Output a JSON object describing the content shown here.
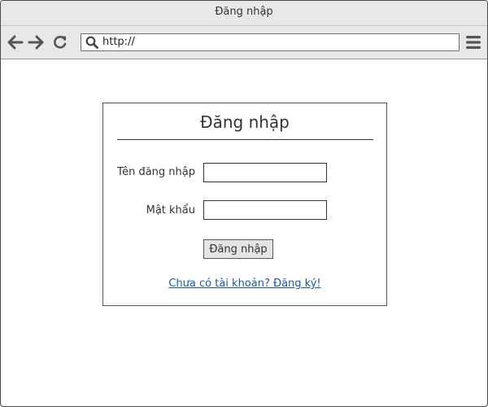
{
  "window": {
    "title": "Đăng nhập"
  },
  "toolbar": {
    "back_icon": "arrow-left-icon",
    "forward_icon": "arrow-right-icon",
    "reload_icon": "reload-icon",
    "search_icon": "search-icon",
    "menu_icon": "hamburger-menu-icon",
    "address_value": "http://"
  },
  "login": {
    "title": "Đăng nhập",
    "username_label": "Tên đăng nhập",
    "username_value": "",
    "password_label": "Mật khẩu",
    "password_value": "",
    "submit_label": "Đăng nhập",
    "register_link": "Chưa có tài khoản? Đăng ký!"
  },
  "colors": {
    "chrome_background": "#e8e8e8",
    "icon_color": "#555555",
    "link_color": "#1a5b9e",
    "button_background": "#e4e4e4"
  }
}
